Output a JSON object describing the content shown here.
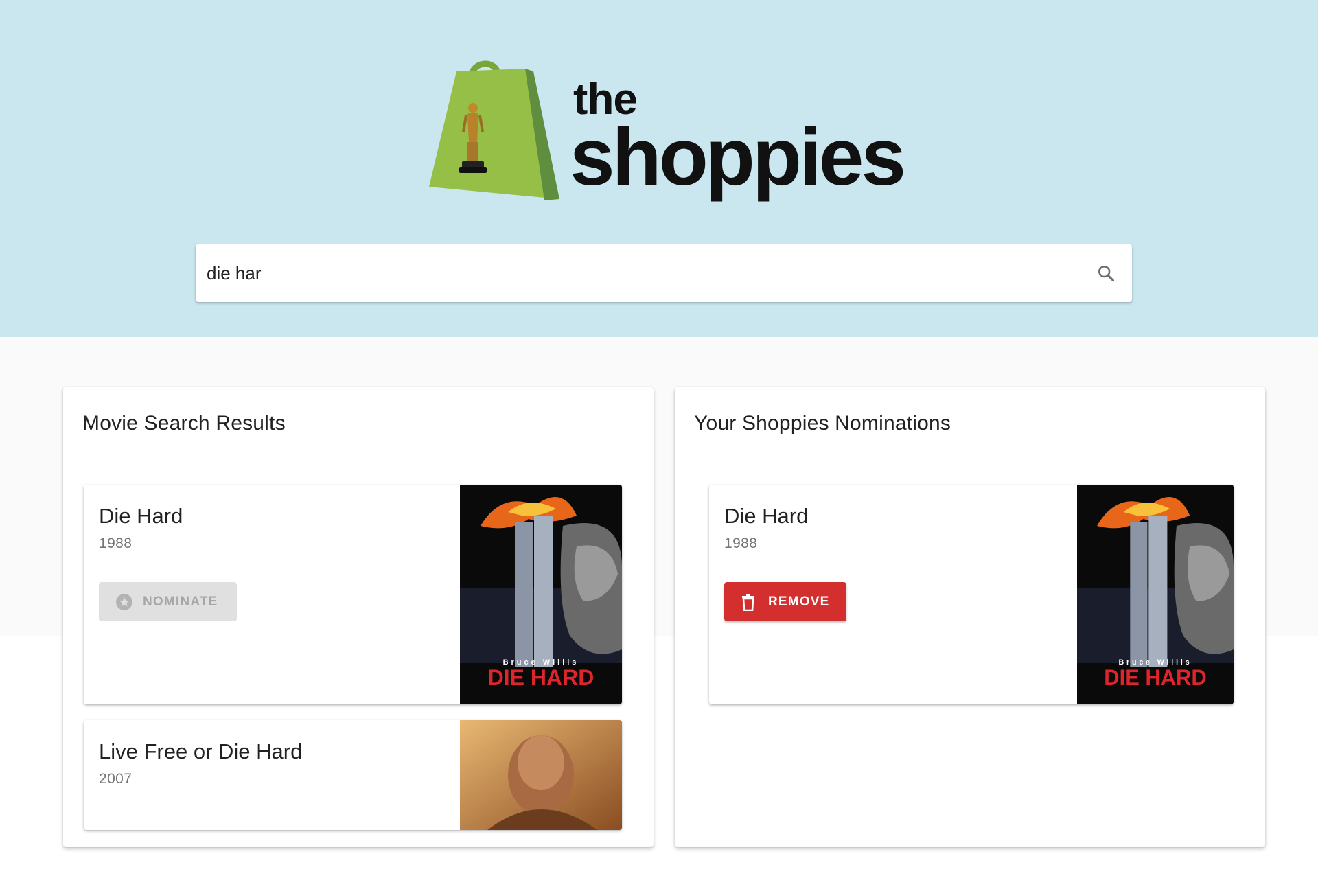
{
  "header": {
    "background_color": "#cae6ef",
    "logo": {
      "the_text": "the",
      "word_text": "shoppies",
      "bag_color": "#95bf47",
      "bag_shade_color": "#5e8e3e"
    },
    "search": {
      "value": "die har",
      "placeholder": "",
      "icon": "search-icon"
    }
  },
  "results_panel": {
    "title": "Movie Search Results",
    "movies": [
      {
        "title": "Die Hard",
        "year": "1988",
        "button_label": "NOMINATE",
        "button_icon": "star-circle-icon",
        "button_state": "disabled",
        "poster": {
          "tagline": "Bruce Willis",
          "poster_title": "DIE HARD"
        }
      },
      {
        "title": "Live Free or Die Hard",
        "year": "2007"
      }
    ]
  },
  "nominations_panel": {
    "title": "Your Shoppies Nominations",
    "movies": [
      {
        "title": "Die Hard",
        "year": "1988",
        "button_label": "REMOVE",
        "button_icon": "trash-icon",
        "button_color": "#d32f2f",
        "poster": {
          "tagline": "Bruce Willis",
          "poster_title": "DIE HARD"
        }
      }
    ]
  }
}
